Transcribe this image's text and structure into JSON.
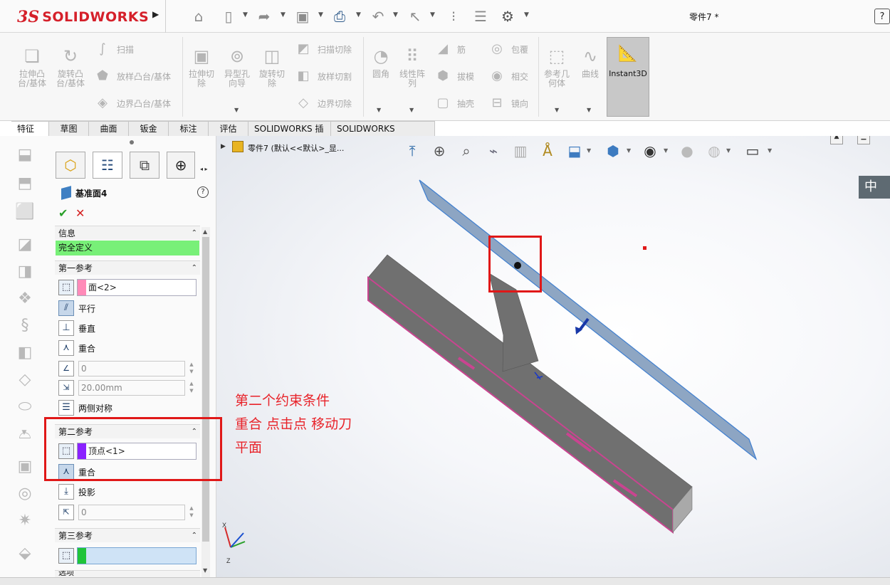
{
  "app": {
    "logo_prefix": "3S",
    "logo_name": "SOLIDWORKS",
    "document_title": "零件7 *",
    "help": "?"
  },
  "ribbon": {
    "extrude_boss": "拉伸凸\n台/基体",
    "revolve_boss": "旋转凸\n台/基体",
    "sweep": "扫描",
    "loft_boss": "放样凸台/基体",
    "boundary_boss": "边界凸台/基体",
    "extrude_cut": "拉伸切\n除",
    "hole_wizard": "异型孔\n向导",
    "revolve_cut": "旋转切\n除",
    "swept_cut": "扫描切除",
    "lofted_cut": "放样切割",
    "boundary_cut": "边界切除",
    "fillet": "圆角",
    "linear_pattern": "线性阵\n列",
    "rib": "筋",
    "draft": "拔模",
    "shell": "抽壳",
    "wrap": "包覆",
    "intersect": "相交",
    "mirror": "镜向",
    "ref_geometry": "参考几\n何体",
    "curves": "曲线",
    "instant3d": "Instant3D"
  },
  "tabs": [
    "特征",
    "草图",
    "曲面",
    "钣金",
    "标注",
    "评估",
    "SOLIDWORKS 插件",
    "SOLIDWORKS Inspection"
  ],
  "property_manager": {
    "title": "基准面4",
    "help": "?",
    "ok": "✔",
    "cancel": "✕",
    "info_header": "信息",
    "status": "完全定义",
    "first_ref": {
      "header": "第一参考",
      "selection": "面<2>",
      "options": [
        "平行",
        "垂直",
        "重合"
      ],
      "angle_value": "0",
      "distance_value": "20.00mm",
      "symmetric": "两侧对称"
    },
    "second_ref": {
      "header": "第二参考",
      "selection": "顶点<1>",
      "options": [
        "重合",
        "投影"
      ],
      "value": "0"
    },
    "third_ref": {
      "header": "第三参考",
      "selection": ""
    },
    "options_header": "选项",
    "swatch_colors": {
      "first": "#ff8ab8",
      "second": "#8a22ff",
      "third": "#1fc43a"
    }
  },
  "graphics": {
    "tree_label": "零件7 (默认<<默认>_显...",
    "side_tab": "中"
  },
  "annotation": {
    "line1": "第二个约束条件",
    "line2": "重合 点击点 移动刀",
    "line3": "平面",
    "color": "#e8232a"
  }
}
